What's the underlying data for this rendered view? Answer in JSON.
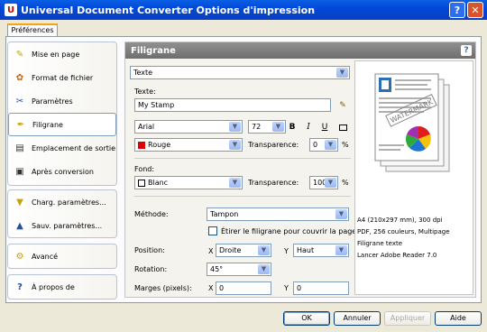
{
  "window": {
    "title": "Universal Document Converter Options d'impression",
    "help_label": "?",
    "close_label": "✕"
  },
  "tabs": [
    {
      "label": "Préférences"
    }
  ],
  "sidebar": {
    "group1": [
      {
        "label": "Mise en page",
        "icon": "page-setup-icon"
      },
      {
        "label": "Format de fichier",
        "icon": "file-format-icon"
      },
      {
        "label": "Paramètres",
        "icon": "settings-icon"
      },
      {
        "label": "Filigrane",
        "icon": "watermark-icon"
      },
      {
        "label": "Emplacement de sortie",
        "icon": "output-location-icon"
      },
      {
        "label": "Après conversion",
        "icon": "after-conversion-icon"
      }
    ],
    "group2": [
      {
        "label": "Charg. paramètres...",
        "icon": "load-settings-icon"
      },
      {
        "label": "Sauv. paramètres...",
        "icon": "save-settings-icon"
      }
    ],
    "group3": [
      {
        "label": "Avancé",
        "icon": "advanced-icon"
      }
    ],
    "group4": [
      {
        "label": "À propos de",
        "icon": "about-icon"
      }
    ]
  },
  "main": {
    "header": "Filigrane",
    "type_select": "Texte",
    "text_label": "Texte:",
    "text_value": "My Stamp",
    "font_select": "Arial",
    "size_select": "72",
    "bold_label": "B",
    "italic_label": "I",
    "underline_label": "U",
    "font_color_select": "Rouge",
    "font_color_hex": "#e00000",
    "transparency_label": "Transparence:",
    "font_transparency": "0",
    "percent": "%",
    "background_label": "Fond:",
    "background_select": "Blanc",
    "background_hex": "#ffffff",
    "bg_transparency": "100",
    "method_label": "Méthode:",
    "method_select": "Tampon",
    "stretch_label": "Étirer le filigrane pour couvrir la page",
    "position_label": "Position:",
    "x_label": "X",
    "y_label": "Y",
    "pos_x_select": "Droite",
    "pos_y_select": "Haut",
    "rotation_label": "Rotation:",
    "rotation_select": "45°",
    "margins_label": "Marges (pixels):",
    "margin_x": "0",
    "margin_y": "0"
  },
  "preview": {
    "watermark_text": "WATERMARK",
    "lines": [
      "A4 (210x297 mm), 300 dpi",
      "PDF, 256 couleurs, Multipage",
      "Filigrane texte",
      "Lancer Adobe Reader 7.0"
    ]
  },
  "buttons": {
    "ok": "OK",
    "cancel": "Annuler",
    "apply": "Appliquer",
    "help": "Aide"
  }
}
